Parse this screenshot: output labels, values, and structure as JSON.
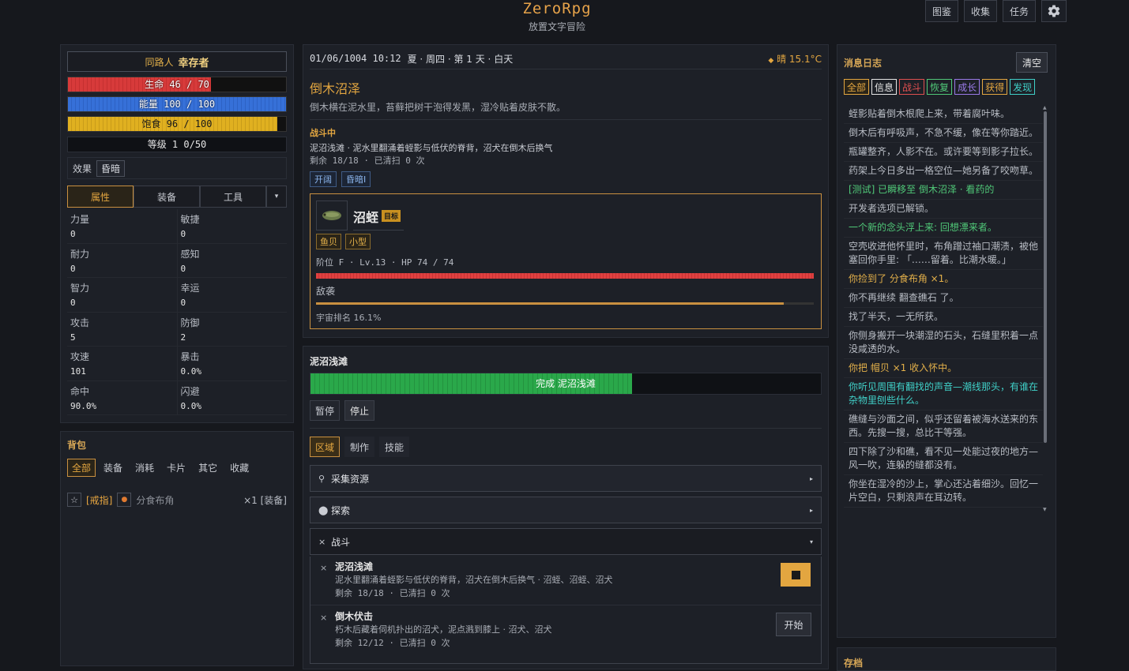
{
  "app": {
    "title": "ZeroRpg",
    "subtitle": "放置文字冒险"
  },
  "nav": {
    "codex": "图鉴",
    "collect": "收集",
    "quest": "任务"
  },
  "character": {
    "tag": "同路人",
    "name": "幸存者",
    "hp": {
      "label": "生命 46 / 70",
      "current": 46,
      "max": 70
    },
    "mp": {
      "label": "能量 100 / 100",
      "current": 100,
      "max": 100
    },
    "food": {
      "label": "饱食 96 / 100",
      "current": 96,
      "max": 100
    },
    "level": "等级 1 0/50",
    "effects_label": "效果",
    "effects": [
      "昏暗"
    ],
    "tabs": [
      "属性",
      "装备",
      "工具"
    ],
    "tab_dropdown": "▾",
    "stats": [
      [
        {
          "k": "力量",
          "v": "0"
        },
        {
          "k": "敏捷",
          "v": "0"
        }
      ],
      [
        {
          "k": "耐力",
          "v": "0"
        },
        {
          "k": "感知",
          "v": "0"
        }
      ],
      [
        {
          "k": "智力",
          "v": "0"
        },
        {
          "k": "幸运",
          "v": "0"
        }
      ],
      [
        {
          "k": "攻击",
          "v": "5"
        },
        {
          "k": "防御",
          "v": "2"
        }
      ],
      [
        {
          "k": "攻速",
          "v": "101"
        },
        {
          "k": "暴击",
          "v": "0.0%"
        }
      ],
      [
        {
          "k": "命中",
          "v": "90.0%"
        },
        {
          "k": "闪避",
          "v": "0.0%"
        }
      ]
    ]
  },
  "bag": {
    "title": "背包",
    "tabs": [
      "全部",
      "装备",
      "消耗",
      "卡片",
      "其它",
      "收藏"
    ],
    "item": {
      "star": "☆",
      "tag": "[戒指]",
      "icon": "●",
      "name": "分食布角",
      "qty": "×1 [装备]"
    }
  },
  "world": {
    "datetime": "01/06/1004 10:12",
    "date_rest": "夏 · 周四 · 第 1 天 · 白天",
    "weather_icon": "◆",
    "weather": "晴 15.1°C",
    "location": "倒木沼泽",
    "location_desc": "倒木横在泥水里，苔藓把树干泡得发黑，湿冷贴着皮肤不散。",
    "combat_label": "战斗中",
    "combat_desc": "泥沼浅滩 · 泥水里翻涌着蛭影与低伏的脊背，沼犬在倒木后换气",
    "combat_remain": "剩余 18/18 · 已清扫 0 次",
    "badges": [
      "开阔",
      "昏暗I"
    ]
  },
  "enemy": {
    "name": "沼蛭",
    "target": "目标",
    "tags": [
      "鱼贝",
      "小型"
    ],
    "meta": "阶位 F · Lv.13 · HP 74 / 74",
    "hp_current": 74,
    "hp_max": 74,
    "intent": "敌袭",
    "intent_progress": 0.94,
    "rank": "宇宙排名 16.1%"
  },
  "activity": {
    "title": "泥沼浅滩",
    "progress_label": "完成 泥沼浅滩",
    "progress": 0.63,
    "pause": "暂停",
    "stop": "停止",
    "tabs": [
      "区域",
      "制作",
      "技能"
    ],
    "sections": [
      {
        "icon": "⚲",
        "label": "采集资源",
        "chev": "▸"
      },
      {
        "icon": "⬤",
        "label": "探索",
        "chev": "▸"
      },
      {
        "icon": "×",
        "label": "战斗",
        "chev": "▾"
      }
    ],
    "combats": [
      {
        "x": "×",
        "title": "泥沼浅滩",
        "desc": "泥水里翻涌着蛭影与低伏的脊背，沼犬在倒木后换气 · 沼蛭、沼蛭、沼犬",
        "remain": "剩余 18/18 · 已清扫 0 次"
      },
      {
        "x": "×",
        "title": "倒木伏击",
        "desc": "朽木后藏着伺机扑出的沼犬，泥点溅到膝上 · 沼犬、沼犬",
        "remain": "剩余 12/12 · 已清扫 0 次",
        "action": "开始"
      }
    ]
  },
  "log": {
    "title": "消息日志",
    "clear": "清空",
    "filters": [
      {
        "label": "全部",
        "color": "#e3a640"
      },
      {
        "label": "信息",
        "color": "#e6e6e6"
      },
      {
        "label": "战斗",
        "color": "#e05050"
      },
      {
        "label": "恢复",
        "color": "#50c878"
      },
      {
        "label": "成长",
        "color": "#9a7ae8"
      },
      {
        "label": "获得",
        "color": "#e3a640"
      },
      {
        "label": "发现",
        "color": "#40d0c8"
      }
    ],
    "entries": [
      {
        "text": "蛭影贴着倒木根爬上来，带着腐叶味。",
        "color": "#b8bcc4"
      },
      {
        "text": "倒木后有呼吸声，不急不缓，像在等你踏近。",
        "color": "#b8bcc4"
      },
      {
        "text": "瓶罐整齐，人影不在。或许要等到影子拉长。",
        "color": "#b8bcc4"
      },
      {
        "text": "药架上今日多出一格空位—她另备了咬吻草。",
        "color": "#b8bcc4"
      },
      {
        "text": "[测试] 已瞬移至 倒木沼泽 · 看药的",
        "color": "#50c878"
      },
      {
        "text": "开发者选项已解锁。",
        "color": "#b8bcc4"
      },
      {
        "text": "一个新的念头浮上来: 回想漂来者。",
        "color": "#50c878"
      },
      {
        "text": "空壳收进他怀里时，布角蹭过袖口潮渍，被他塞回你手里: 「……留着。比潮水暖。」",
        "color": "#b8bcc4"
      },
      {
        "text": "你捡到了 分食布角 ×1。",
        "color": "#e3b04a"
      },
      {
        "text": "你不再继续 翻查礁石 了。",
        "color": "#b8bcc4"
      },
      {
        "text": "找了半天，一无所获。",
        "color": "#b8bcc4"
      },
      {
        "text": "你侧身搬开一块潮湿的石头，石缝里积着一点没咸透的水。",
        "color": "#b8bcc4"
      },
      {
        "text": "你把 帽贝 ×1 收入怀中。",
        "color": "#e3b04a"
      },
      {
        "text": "你听见周围有翻找的声音—潮线那头，有谁在杂物里刨些什么。",
        "color": "#40d0c8"
      },
      {
        "text": "礁缝与沙面之间，似乎还留着被海水送来的东西。先搜一搜，总比干等强。",
        "color": "#b8bcc4"
      },
      {
        "text": "四下除了沙和礁，看不见一处能过夜的地方—风一吹，连躲的缝都没有。",
        "color": "#b8bcc4"
      },
      {
        "text": "你坐在湿冷的沙上，掌心还沾着细沙。回忆一片空白，只剩浪声在耳边转。",
        "color": "#b8bcc4"
      }
    ]
  },
  "storage": {
    "title": "存档"
  }
}
